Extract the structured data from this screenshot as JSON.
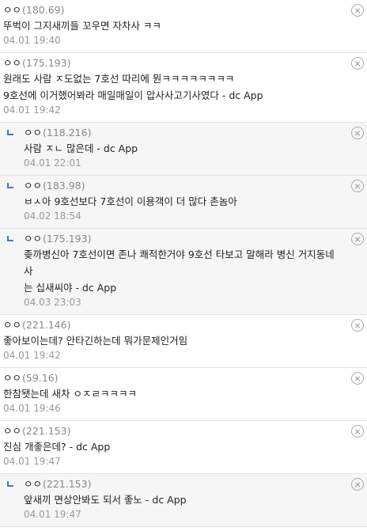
{
  "comments": [
    {
      "nick": "ㅇㅇ",
      "ip": "(180.69)",
      "reply": false,
      "lines": [
        "뚜벅이 그지새끼들 꼬우면 자차사 ㅋㅋ"
      ],
      "date": "04.01 19:40"
    },
    {
      "nick": "ㅇㅇ",
      "ip": "(175.193)",
      "reply": false,
      "lines": [
        "원래도 사람 ㅈ도없는 7호선 따리에 뭔ㅋㅋㅋㅋㅋㅋㅋㅋ",
        "9호선에 이거했어봐라 매일매일이 압사사고기사였다 - dc App"
      ],
      "date": "04.01 19:42"
    },
    {
      "nick": "ㅇㅇ",
      "ip": "(118.216)",
      "reply": true,
      "lines": [
        "사람 ㅈㄴ 많은데 - dc App"
      ],
      "date": "04.01 22:01"
    },
    {
      "nick": "ㅇㅇ",
      "ip": "(183.98)",
      "reply": true,
      "lines": [
        "ㅂㅅ아 9호선보다 7호선이 이용객이 더 많다 촌놈아"
      ],
      "date": "04.02 18:54"
    },
    {
      "nick": "ㅇㅇ",
      "ip": "(175.193)",
      "reply": true,
      "lines": [
        "좆까병신아 7호선이면 존나 쾌적한거야 9호선 타보고 말해라 병신 거지동네사",
        "는 십새씨야 - dc App"
      ],
      "date": "04.03 23:03"
    },
    {
      "nick": "ㅇㅇ",
      "ip": "(221.146)",
      "reply": false,
      "lines": [
        "좋아보이는데? 안타긴하는데 뭐가문제인거임"
      ],
      "date": "04.01 19:42"
    },
    {
      "nick": "ㅇㅇ",
      "ip": "(59.16)",
      "reply": false,
      "lines": [
        "한참됏는데 새차 ㅇㅈㄹㅋㅋㅋㅋ"
      ],
      "date": "04.01 19:46"
    },
    {
      "nick": "ㅇㅇ",
      "ip": "(221.153)",
      "reply": false,
      "lines": [
        "진심 개좋은데? - dc App"
      ],
      "date": "04.01 19:47"
    },
    {
      "nick": "ㅇㅇ",
      "ip": "(221.153)",
      "reply": true,
      "lines": [
        "앞새끼 면상안봐도 되서 좋노 - dc App"
      ],
      "date": "04.01 19:47"
    }
  ],
  "icons": {
    "delete": "close-circle-icon",
    "reply": "reply-arrow-icon"
  },
  "colors": {
    "reply_bg": "#f6f6f6",
    "reply_mark": "#4a78b8",
    "ip": "#888888",
    "date": "#999999"
  }
}
